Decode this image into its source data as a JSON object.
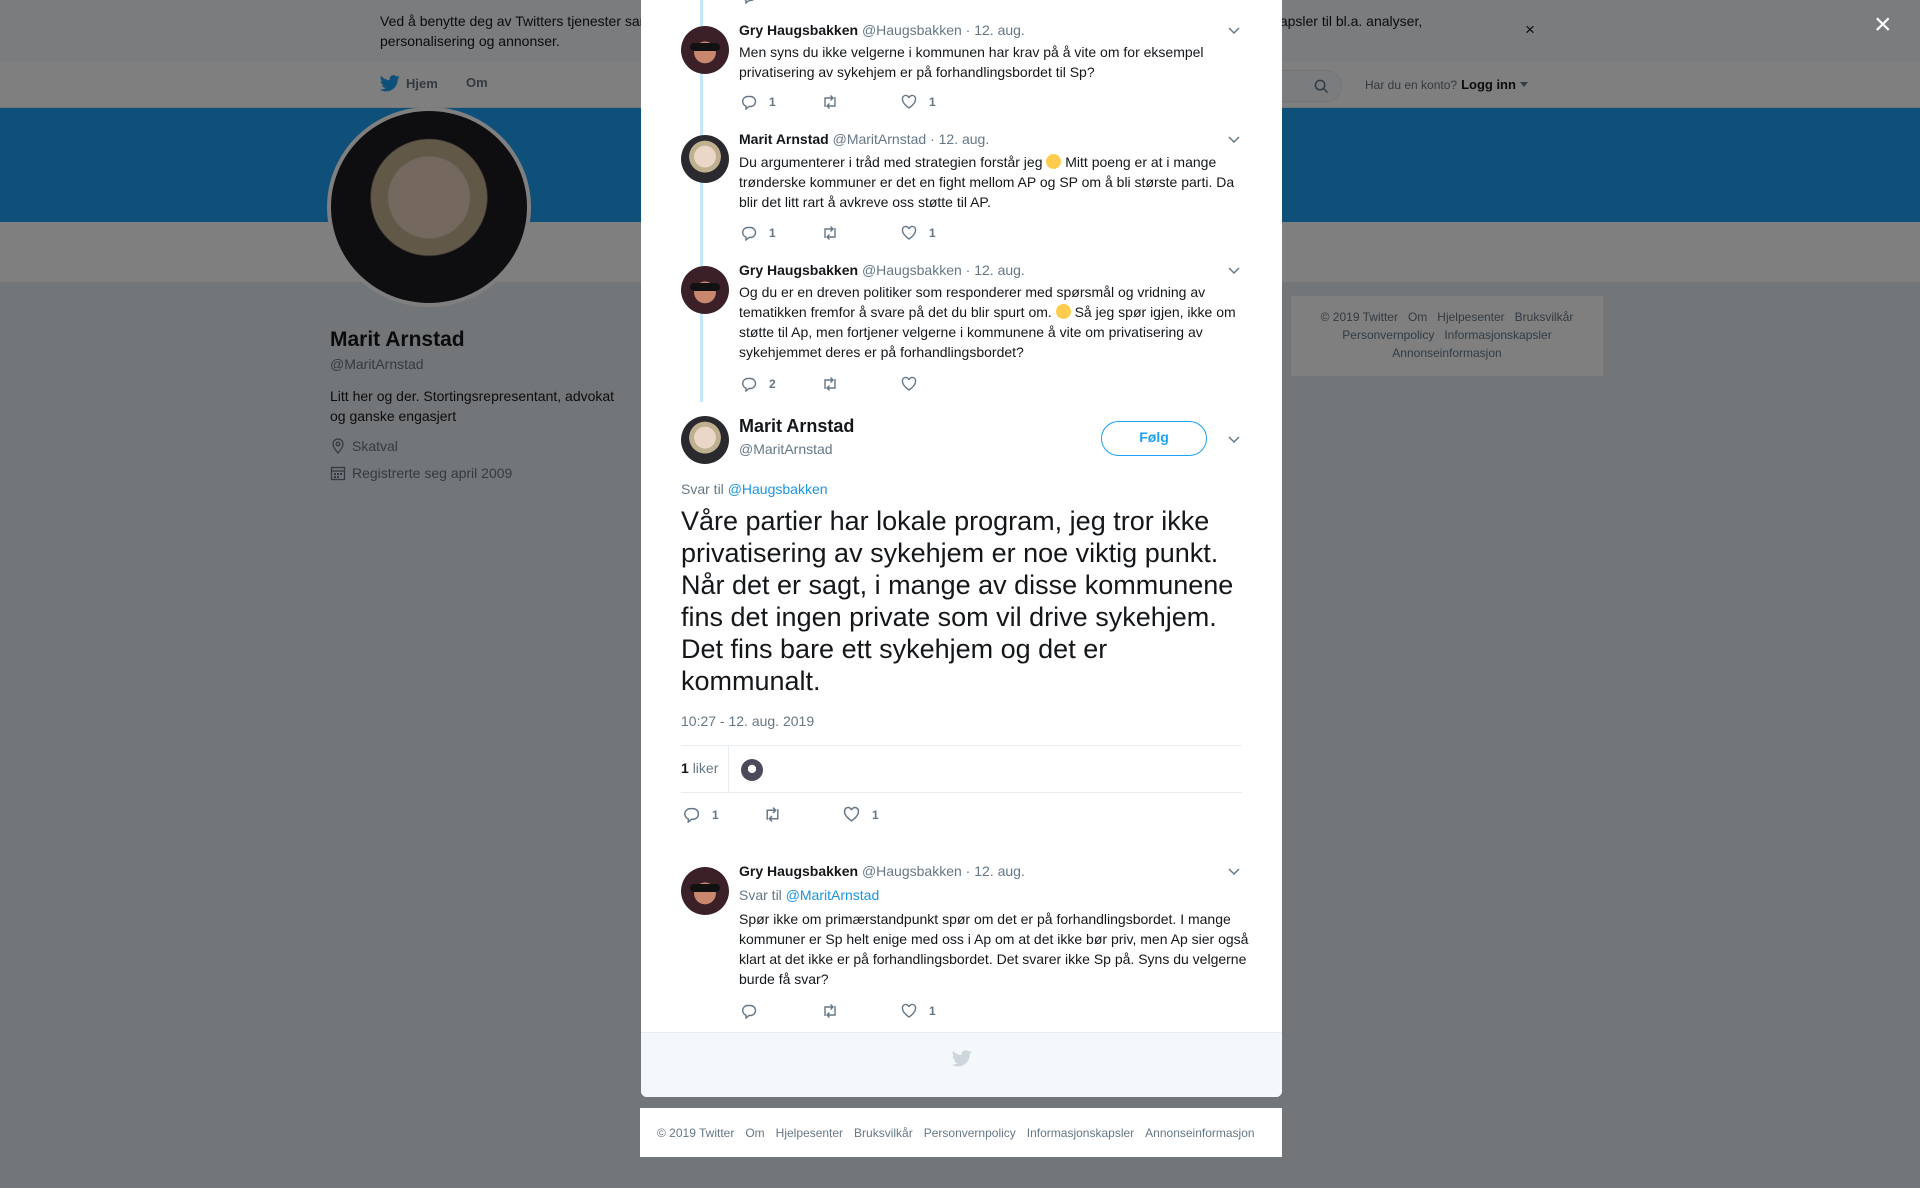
{
  "cookie_banner": {
    "text": "Ved å benytte deg av Twitters tjenester samtykker du i vår bruk av informasjonskapsler. Vi og våre partnere driver globalt og bruker informasjonskapsler til bl.a. analyser, personalisering og annonser.",
    "close": "×"
  },
  "nav": {
    "home": "Hjem",
    "about": "Om",
    "login_prompt": "Har du en konto?",
    "login": "Logg inn"
  },
  "profile": {
    "name": "Marit Arnstad",
    "handle": "@MaritArnstad",
    "bio": "Litt her og der. Stortingsrepresentant, advokat og ganske engasjert",
    "location": "Skatval",
    "joined": "Registrerte seg april 2009"
  },
  "side_footer": [
    "© 2019 Twitter",
    "Om",
    "Hjelpesenter",
    "Bruksvilkår",
    "Personvernpolicy",
    "Informasjonskapsler",
    "Annonseinformasjon"
  ],
  "overlay_close": "×",
  "tweets": [
    {
      "name": "Gry Haugsbakken",
      "handle": "@Haugsbakken",
      "date": "· 12. aug.",
      "text": "Men syns du ikke velgerne i kommunen har krav på å vite om for eksempel privatisering av sykehjem er på forhandlingsbordet til Sp?",
      "replies": "1",
      "retweets": "",
      "likes": "1"
    },
    {
      "name": "Marit Arnstad",
      "handle": "@MaritArnstad",
      "date": "· 12. aug.",
      "text_a": "Du argumenterer i tråd med strategien forstår jeg ",
      "text_b": " Mitt poeng er at i mange trønderske kommuner er det en fight mellom AP og SP om å bli største parti. Da blir det litt rart å avkreve oss støtte til AP.",
      "replies": "1",
      "retweets": "",
      "likes": "1"
    },
    {
      "name": "Gry Haugsbakken",
      "handle": "@Haugsbakken",
      "date": "· 12. aug.",
      "text_a": "Og du er en dreven politiker som responderer med spørsmål og vridning av tematikken fremfor å svare på det du blir spurt om. ",
      "text_b": " Så jeg spør igjen, ikke om støtte til Ap, men fortjener velgerne i kommunene å vite om privatisering av sykehjemmet deres er på forhandlingsbordet?",
      "replies": "2",
      "retweets": "",
      "likes": ""
    }
  ],
  "main_tweet": {
    "name": "Marit Arnstad",
    "handle": "@MaritArnstad",
    "follow": "Følg",
    "reply_to_label": "Svar til",
    "reply_to_handle": "@Haugsbakken",
    "text": "Våre partier har lokale program, jeg tror ikke privatisering av sykehjem er noe viktig punkt. Når det er sagt, i mange av disse kommunene fins det ingen private som vil drive sykehjem. Det fins bare ett sykehjem og det er kommunalt.",
    "timestamp": "10:27 - 12. aug. 2019",
    "likes_count": "1",
    "likes_label": "liker",
    "replies": "1",
    "retweets": "",
    "likes": "1"
  },
  "reply_tweet": {
    "name": "Gry Haugsbakken",
    "handle": "@Haugsbakken",
    "date": "· 12. aug.",
    "reply_to_label": "Svar til",
    "reply_to_handle": "@MaritArnstad",
    "text": "Spør ikke om primærstandpunkt spør om det er på forhandlingsbordet. I mange kommuner er Sp helt enige med oss i Ap om at det ikke bør priv, men Ap sier også klart at det ikke er på forhandlingsbordet. Det svarer ikke Sp på. Syns du velgerne burde få svar?",
    "replies": "",
    "retweets": "",
    "likes": "1"
  },
  "footer": [
    "© 2019 Twitter",
    "Om",
    "Hjelpesenter",
    "Bruksvilkår",
    "Personvernpolicy",
    "Informasjonskapsler",
    "Annonseinformasjon"
  ],
  "colors": {
    "twitter_blue": "#1da1f2",
    "link_blue": "#1b95e0",
    "thread_line": "#c4e7fd",
    "text_gray": "#657786"
  }
}
